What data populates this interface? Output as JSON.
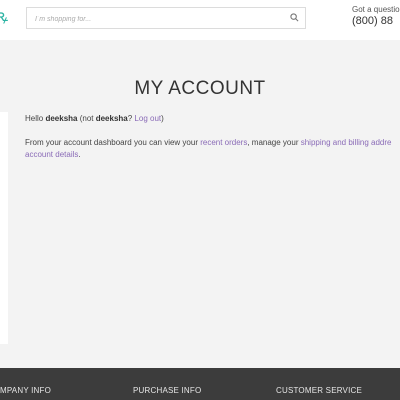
{
  "header": {
    "search": {
      "placeholder": "I´m shopping for..."
    },
    "contact": {
      "question": "Got a question",
      "phone": "(800) 88"
    }
  },
  "main": {
    "title": "MY ACCOUNT",
    "greeting": {
      "hello": "Hello ",
      "user": "deeksha",
      "not_open": " (not ",
      "not_user": "deeksha",
      "q": "? ",
      "logout": "Log out",
      "close": ")"
    },
    "dashboard": {
      "prefix": "From your account dashboard you can view your ",
      "recent_orders": "recent orders",
      "middle": ", manage your ",
      "addresses": "shipping and billing addre",
      "account_details": "account details",
      "suffix": "."
    }
  },
  "footer": {
    "columns": [
      "MPANY INFO",
      "PURCHASE INFO",
      "CUSTOMER SERVICE"
    ]
  },
  "colors": {
    "accent": "#8a6bb7",
    "logo": "#2bb3a3",
    "footer_bg": "#3c3c3c"
  }
}
